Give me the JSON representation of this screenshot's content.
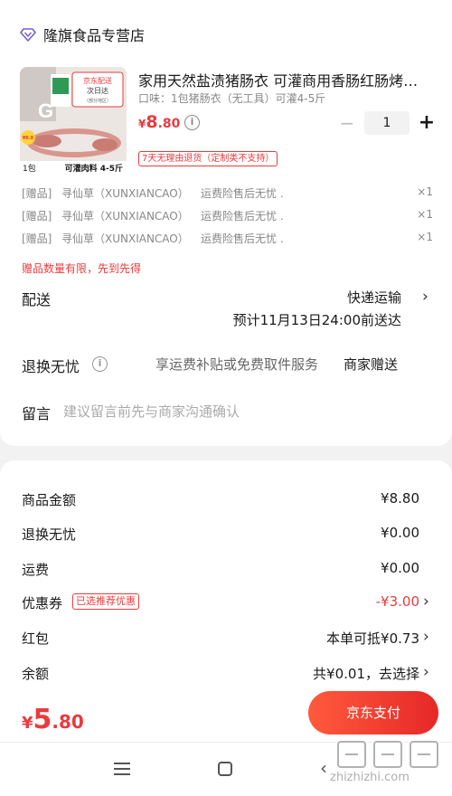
{
  "store": {
    "name": "隆旗食品专营店",
    "icon": "store-diamond-icon"
  },
  "product": {
    "title": "家用天然盐渍猪肠衣 可灌商用香肠红肠烤肠肠衣",
    "spec": "口味：1包猪肠衣（无工具）可灌4-5斤",
    "price_currency": "¥",
    "price_int": "8",
    "price_dec": ".80",
    "quantity": "1",
    "return_tag": "7天无理由退货（定制类不支持）",
    "image": {
      "badge_top": "京东配送",
      "badge_sub": "次日达",
      "badge_note": "（部分地区）",
      "price_sticker": "¥8.8",
      "caption_left": "1包",
      "caption_right": "可灌肉料 4-5斤",
      "brand_letter": "G"
    }
  },
  "gifts": [
    {
      "tag": "[赠品]",
      "name": "寻仙草（XUNXIANCAO）",
      "desc": "运费险售后无忧 .",
      "qty": "×1"
    },
    {
      "tag": "[赠品]",
      "name": "寻仙草（XUNXIANCAO）",
      "desc": "运费险售后无忧 .",
      "qty": "×1"
    },
    {
      "tag": "[赠品]",
      "name": "寻仙草（XUNXIANCAO）",
      "desc": "运费险售后无忧 .",
      "qty": "×1"
    }
  ],
  "gift_limit": "赠品数量有限，先到先得",
  "delivery": {
    "label": "配送",
    "method": "快递运输",
    "eta": "预计11月13日24:00前送达"
  },
  "returns": {
    "label": "退换无忧",
    "desc": "享运费补贴或免费取件服务",
    "value": "商家赠送"
  },
  "message": {
    "label": "留言",
    "placeholder": "建议留言前先与商家沟通确认"
  },
  "summary": {
    "goods": {
      "label": "商品金额",
      "value": "¥8.80"
    },
    "returns": {
      "label": "退换无忧",
      "value": "¥0.00"
    },
    "shipping": {
      "label": "运费",
      "value": "¥0.00"
    },
    "coupon": {
      "label": "优惠券",
      "badge": "已选推荐优惠",
      "value": "-¥3.00"
    },
    "redpacket": {
      "label": "红包",
      "value": "本单可抵¥0.73"
    },
    "balance": {
      "label": "余额",
      "value": "共¥0.01，去选择"
    }
  },
  "total": {
    "currency": "¥",
    "int": "5",
    "dec": ".80"
  },
  "pay_button": "京东支付",
  "watermark": "zhizhizhi.com",
  "colors": {
    "accent": "#e93b3d",
    "pay_gradient_start": "#ff5a3c",
    "pay_gradient_end": "#e62828"
  }
}
